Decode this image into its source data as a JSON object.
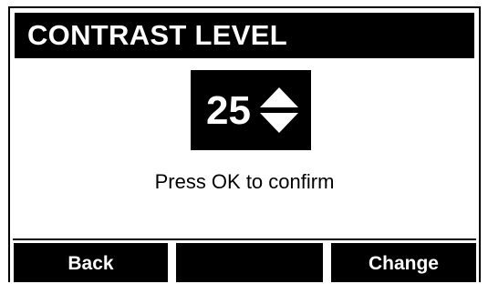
{
  "screen": {
    "title": "CONTRAST LEVEL",
    "value": "25",
    "prompt": "Press OK to confirm",
    "icon": "up-down-arrows-icon",
    "colors": {
      "foreground": "#000000",
      "background": "#ffffff"
    }
  },
  "softkeys": {
    "left_label": "Back",
    "middle_label": "",
    "right_label": "Change"
  }
}
